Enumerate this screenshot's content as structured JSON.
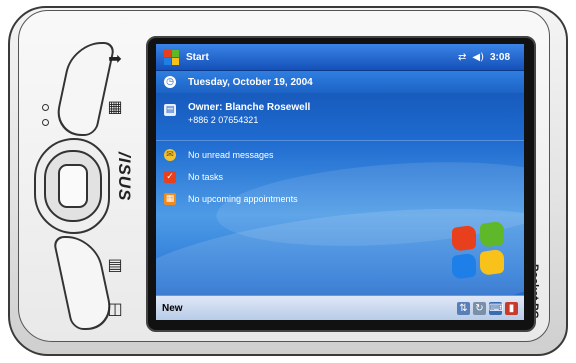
{
  "taskbar": {
    "start_label": "Start",
    "time": "3:08",
    "connectivity_icon": "connectivity-icon",
    "volume_icon": "speaker-icon"
  },
  "today": {
    "date": "Tuesday, October 19, 2004",
    "owner_name": "Owner: Blanche Rosewell",
    "owner_phone": "+886 2 07654321",
    "messages": "No unread messages",
    "tasks": "No tasks",
    "appointments": "No upcoming appointments"
  },
  "softkeys": {
    "left": "New"
  },
  "device": {
    "brand": "/ISUS",
    "label": "Pocket PC"
  },
  "colors": {
    "screen_top": "#0f4aa8",
    "taskbar": "#1450b8",
    "bottom_bar": "#c9d8ee",
    "device_body": "#e6e6e6"
  }
}
